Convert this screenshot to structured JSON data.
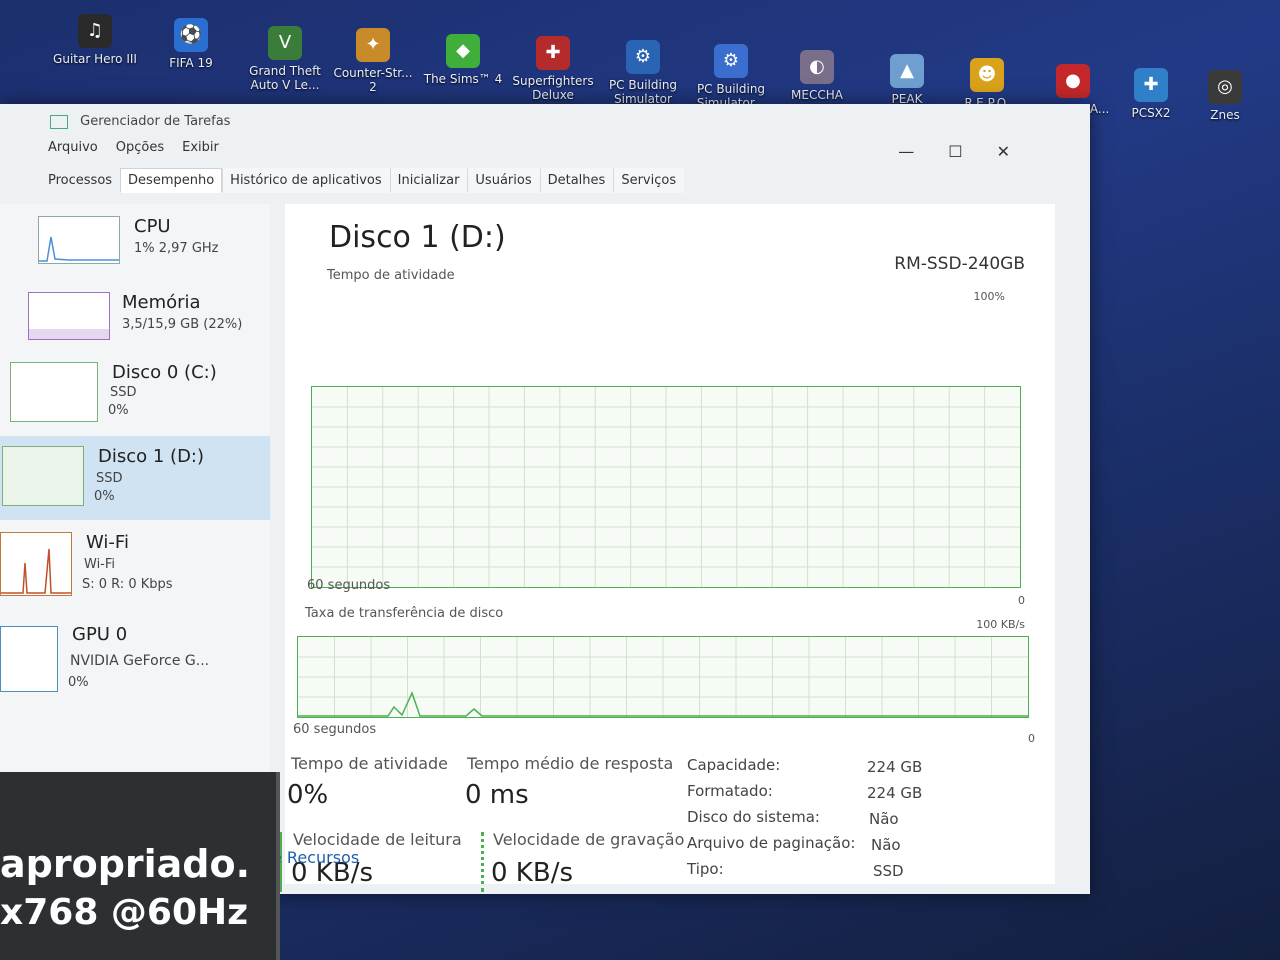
{
  "desktop": {
    "icons": [
      {
        "name": "guitar-hero",
        "label": "Guitar Hero III",
        "color": "#2a2a2a",
        "glyph": "♫"
      },
      {
        "name": "fifa-19",
        "label": "FIFA 19",
        "color": "#2a6fcf",
        "glyph": "⚽"
      },
      {
        "name": "gta-v",
        "label": "Grand Theft Auto V Le...",
        "color": "#3a7d3a",
        "glyph": "V"
      },
      {
        "name": "counter-strike-2",
        "label": "Counter-Str... 2",
        "color": "#c98a2a",
        "glyph": "✦"
      },
      {
        "name": "the-sims-4",
        "label": "The Sims™ 4",
        "color": "#3fae3a",
        "glyph": "◆"
      },
      {
        "name": "superfighters",
        "label": "Superfighters Deluxe",
        "color": "#b52a2a",
        "glyph": "✚"
      },
      {
        "name": "pc-building-sim",
        "label": "PC Building Simulator",
        "color": "#2a64b5",
        "glyph": "⚙"
      },
      {
        "name": "pc-building-sim-2",
        "label": "PC Building Simulator...",
        "color": "#3a6fd0",
        "glyph": "⚙"
      },
      {
        "name": "meccha-chameleon",
        "label": "MECCHA CHAMELE...",
        "color": "#7a6f8a",
        "glyph": "◐"
      },
      {
        "name": "peak",
        "label": "PEAK",
        "color": "#6f9fd0",
        "glyph": "▲"
      },
      {
        "name": "repo",
        "label": "R.E.P.O.",
        "color": "#d9a21a",
        "glyph": "☻"
      },
      {
        "name": "bombana",
        "label": "BOMBANA... Demo",
        "color": "#c4282a",
        "glyph": "●"
      },
      {
        "name": "pcsx2",
        "label": "PCSX2",
        "color": "#2f7fc9",
        "glyph": "✚"
      },
      {
        "name": "znes",
        "label": "Znes",
        "color": "#3a3a3a",
        "glyph": "◎"
      }
    ]
  },
  "window": {
    "title": "Gerenciador de Tarefas",
    "menu": [
      "Arquivo",
      "Opções",
      "Exibir"
    ],
    "tabs": [
      "Processos",
      "Desempenho",
      "Histórico de aplicativos",
      "Inicializar",
      "Usuários",
      "Detalhes",
      "Serviços"
    ],
    "controls": {
      "minimize": "—",
      "maximize": "☐",
      "close": "✕"
    }
  },
  "sidebar": [
    {
      "name": "CPU",
      "sub1": "1% 2,97 GHz",
      "sub2": "",
      "sub3": ""
    },
    {
      "name": "Memória",
      "sub1": "3,5/15,9 GB (22%)",
      "sub2": "",
      "sub3": ""
    },
    {
      "name": "Disco 0 (C:)",
      "sub1": "SSD",
      "sub2": "0%",
      "sub3": ""
    },
    {
      "name": "Disco 1 (D:)",
      "sub1": "SSD",
      "sub2": "0%",
      "sub3": ""
    },
    {
      "name": "Wi-Fi",
      "sub1": "Wi-Fi",
      "sub2": "S: 0 R: 0 Kbps",
      "sub3": ""
    },
    {
      "name": "GPU 0",
      "sub1": "NVIDIA GeForce G...",
      "sub2": "0%",
      "sub3": ""
    }
  ],
  "main": {
    "title": "Disco 1 (D:)",
    "model": "RM-SSD-240GB",
    "graph1": {
      "label": "Tempo de atividade",
      "max": "100%",
      "foot_left": "60 segundos",
      "foot_right": "0"
    },
    "graph2": {
      "label": "Taxa de transferência de disco",
      "max": "100 KB/s",
      "foot_left": "60 segundos",
      "foot_right": "0"
    },
    "stats": {
      "activity_label": "Tempo de atividade",
      "activity_value": "0%",
      "response_label": "Tempo médio de resposta",
      "response_value": "0 ms",
      "read_label": "Velocidade de leitura",
      "read_value": "0 KB/s",
      "write_label": "Velocidade de gravação",
      "write_value": "0 KB/s"
    },
    "props": [
      {
        "k": "Capacidade:",
        "v": "224 GB"
      },
      {
        "k": "Formatado:",
        "v": "224 GB"
      },
      {
        "k": "Disco do sistema:",
        "v": "Não"
      },
      {
        "k": "Arquivo de paginação:",
        "v": "Não"
      },
      {
        "k": "Tipo:",
        "v": "SSD"
      }
    ],
    "link": "e Recursos"
  },
  "overlay": {
    "line1": "apropriado.",
    "line2": "x768 @60Hz"
  }
}
